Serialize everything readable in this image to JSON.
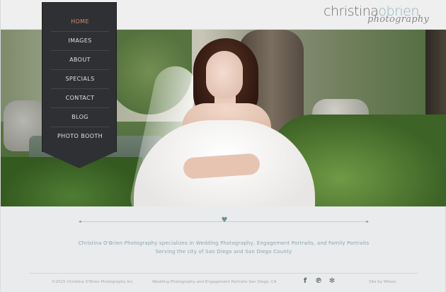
{
  "brand": {
    "name_main": "christina",
    "name_accent": "obrien",
    "name_script": "photography"
  },
  "nav": {
    "items": [
      {
        "label": "HOME",
        "active": true
      },
      {
        "label": "IMAGES",
        "active": false
      },
      {
        "label": "ABOUT",
        "active": false
      },
      {
        "label": "SPECIALS",
        "active": false
      },
      {
        "label": "CONTACT",
        "active": false
      },
      {
        "label": "BLOG",
        "active": false
      },
      {
        "label": "PHOTO BOOTH",
        "active": false
      }
    ]
  },
  "content": {
    "tagline_line1": "Christina O'Brien Photography specializes in Wedding Photography, Engagement Portraits, and Family Portraits",
    "tagline_line2": "Serving the city of San Diego and San Diego County"
  },
  "footer": {
    "copyright": "©2015 Christina O'Brien Photography Inc.",
    "middle": "Wedding Photography and Engagement Portraits San Diego, CA",
    "credit": "Site by Wilson"
  },
  "icons": {
    "divider": "heart-icon",
    "social": [
      "facebook-icon",
      "pinterest-icon",
      "yelp-icon"
    ]
  },
  "colors": {
    "nav_bg": "#2f3033",
    "nav_active": "#d58a6f",
    "accent": "#8fb3bb",
    "tagline": "#8aa6ae"
  }
}
